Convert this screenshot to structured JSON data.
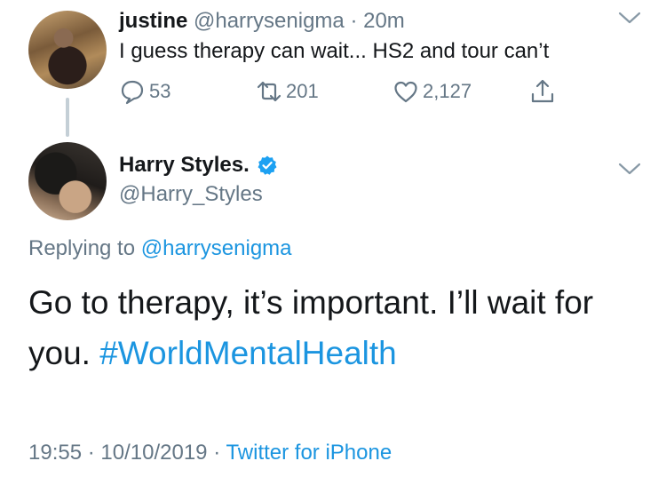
{
  "reply_tweet": {
    "author_name": "justine",
    "author_handle": "@harrysenigma",
    "time_sep": "·",
    "time": "20m",
    "text": "I guess therapy can wait... HS2 and tour can’t",
    "actions": {
      "reply_count": "53",
      "retweet_count": "201",
      "like_count": "2,127"
    }
  },
  "main_tweet": {
    "author_name": "Harry Styles.",
    "author_handle": "@Harry_Styles",
    "replying_prefix": "Replying to",
    "replying_handle": "@harrysenigma",
    "text_body": "Go to therapy, it’s important. I’ll wait for you.",
    "hashtag": "#WorldMentalHealth",
    "time": "19:55",
    "date": "10/10/2019",
    "sep": "·",
    "source": "Twitter for iPhone"
  },
  "colors": {
    "link": "#1b95e0",
    "muted": "#657786",
    "verified": "#1da1f2"
  },
  "icons": [
    "reply-icon",
    "retweet-icon",
    "like-icon",
    "share-icon",
    "chevron-down-icon",
    "verified-badge-icon"
  ]
}
